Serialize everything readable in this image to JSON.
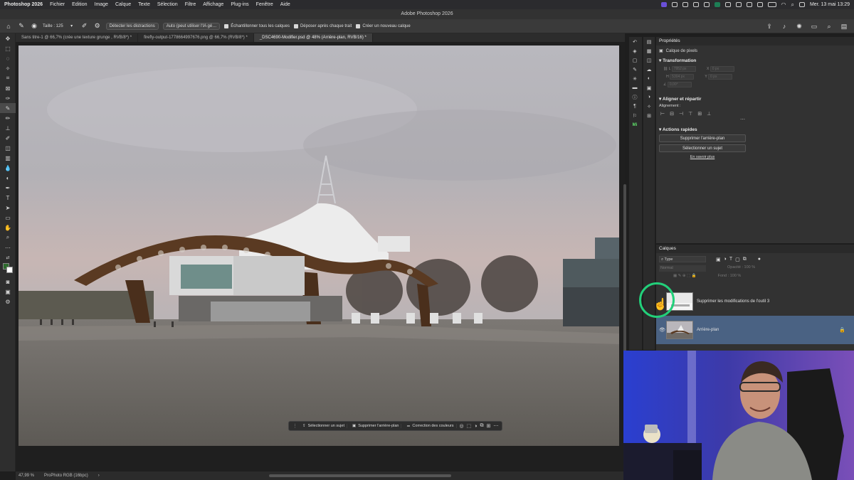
{
  "menubar": {
    "items": [
      "Photoshop 2026",
      "Fichier",
      "Edition",
      "Image",
      "Calque",
      "Texte",
      "Sélection",
      "Filtre",
      "Affichage",
      "Plug-ins",
      "Fenêtre",
      "Aide"
    ],
    "clock": "Mer. 13 mai  13:29"
  },
  "window": {
    "title": "Adobe Photoshop 2026"
  },
  "options": {
    "size_label": "Taille : 125",
    "detect_button": "Détecter les distractions",
    "mode_select": "Auto (peut utiliser l'IA gé…",
    "sample_all": "Échantillonner tous les calques",
    "deposit_after": "Déposer après chaque trait",
    "new_layer": "Créer un nouveau calque"
  },
  "tabs": [
    {
      "label": "Sans titre-1 @ 66,7% (crée une texture grunge     , RVB/8*) *",
      "active": false
    },
    {
      "label": "firefly-output-1778664997676.png @ 66,7% (RVB/8*) *",
      "active": false
    },
    {
      "label": "_DSC4690-Modifier.psd @ 48% (Arrière-plan, RVB/16) *",
      "active": true
    }
  ],
  "context_bar": {
    "select_subject": "Sélectionner un sujet",
    "remove_bg": "Supprimer l'arrière-plan",
    "color_correction": "Correction des couleurs"
  },
  "status": {
    "zoom": "47,99 %",
    "profile": "ProPhoto RGB (16bpc)"
  },
  "properties": {
    "panel_title": "Propriétés",
    "layer_type": "Calque de pixels",
    "transform_title": "Transformation",
    "fields": {
      "w": "7952 px",
      "x": "0 px",
      "h": "5304 px",
      "y": "0 px",
      "angle": "0,00°"
    },
    "align_title": "Aligner et répartir",
    "align_label": "Alignement :",
    "quick_title": "Actions rapides",
    "remove_bg_btn": "Supprimer l'arrière-plan",
    "select_subject_btn": "Sélectionner un sujet",
    "learn_more": "En savoir plus"
  },
  "layers": {
    "panel_title": "Calques",
    "filter": "Type",
    "blend_mode": "Normal",
    "opacity_label": "Opacité : 100 %",
    "fill_label": "Fond : 100 %",
    "items": [
      {
        "name": "Supprimer les modifications de l'outil 3"
      },
      {
        "name": "Arrière-plan"
      }
    ]
  },
  "colors": {
    "selected_layer": "#4a6283",
    "cursor_ring": "#22d07a",
    "foreground": "#2e6b2e"
  }
}
